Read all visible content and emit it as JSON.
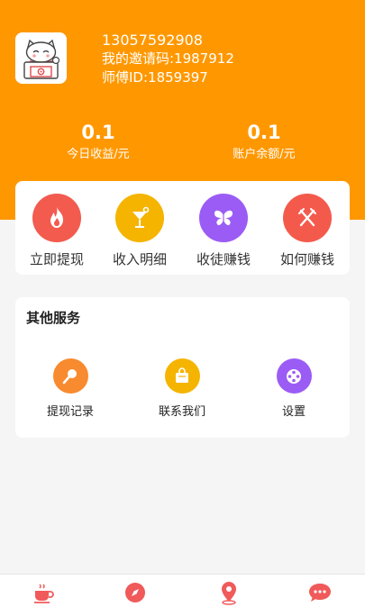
{
  "user": {
    "phone": "13057592908",
    "invite_code": "我的邀请码:1987912",
    "master_id": "师傅ID:1859397",
    "avatar_icon": "lucky-cat-icon"
  },
  "stats": [
    {
      "value": "0.1",
      "label": "今日收益/元"
    },
    {
      "value": "0.1",
      "label": "账户余额/元"
    }
  ],
  "actions": [
    {
      "label": "立即提现",
      "icon": "flame-icon",
      "color": "#f25b4e"
    },
    {
      "label": "收入明细",
      "icon": "cocktail-icon",
      "color": "#f5b400"
    },
    {
      "label": "收徒赚钱",
      "icon": "butterfly-icon",
      "color": "#9b5cf5"
    },
    {
      "label": "如何赚钱",
      "icon": "fork-knife-icon",
      "color": "#f45a4c"
    }
  ],
  "services": {
    "title": "其他服务",
    "items": [
      {
        "label": "提现记录",
        "icon": "microphone-icon",
        "color": "#f88a2f"
      },
      {
        "label": "联系我们",
        "icon": "shopping-bag-icon",
        "color": "#f5b400"
      },
      {
        "label": "设置",
        "icon": "film-reel-icon",
        "color": "#9b5cf5"
      }
    ]
  },
  "tabbar": {
    "items": [
      {
        "icon": "coffee-cup-icon"
      },
      {
        "icon": "compass-icon"
      },
      {
        "icon": "location-pin-icon"
      },
      {
        "icon": "chat-bubble-icon"
      }
    ],
    "color": "#f05a5a"
  }
}
